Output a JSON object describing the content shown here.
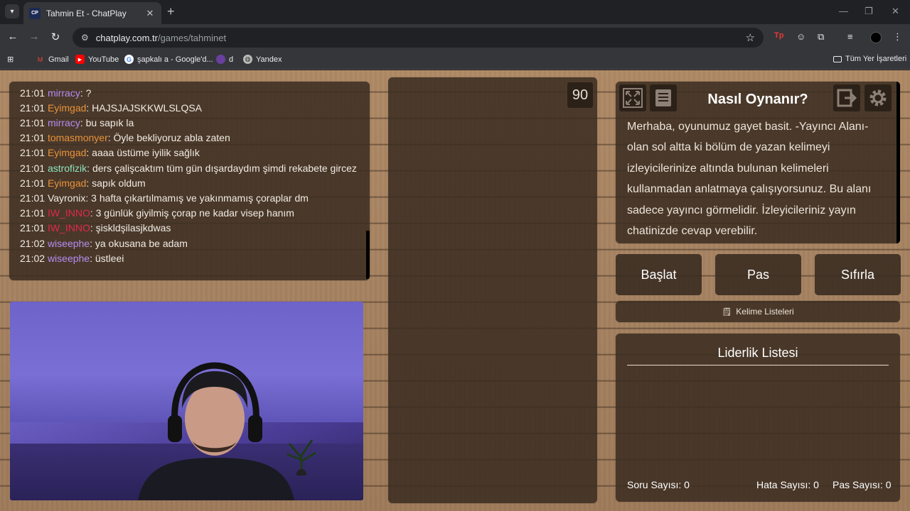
{
  "browser": {
    "tab_title": "Tahmin Et - ChatPlay",
    "tab_favicon": "CP",
    "url_host": "chatplay.com.tr",
    "url_path": "/games/tahminet",
    "bookmarks": [
      {
        "label": "Gmail",
        "icon": "gmail-icon"
      },
      {
        "label": "YouTube",
        "icon": "youtube-icon"
      },
      {
        "label": "şapkalı a - Google'd...",
        "icon": "google-icon"
      },
      {
        "label": "d",
        "icon": "avatar-icon"
      },
      {
        "label": "Yandex",
        "icon": "globe-icon"
      }
    ],
    "all_bookmarks": "Tüm Yer İşaretleri"
  },
  "chat": {
    "messages": [
      {
        "time": "21:01",
        "user": "mirracy",
        "color": "#b58cf2",
        "text": ": ?"
      },
      {
        "time": "21:01",
        "user": "Eyimgad",
        "color": "#e8923a",
        "text": ": HAJSJAJSKKWLSLQSA"
      },
      {
        "time": "21:01",
        "user": "mirracy",
        "color": "#b58cf2",
        "text": ": bu sapık la"
      },
      {
        "time": "21:01",
        "user": "tomasmonyer",
        "color": "#e8923a",
        "text": ": Öyle bekliyoruz abla zaten"
      },
      {
        "time": "21:01",
        "user": "Eyimgad",
        "color": "#e8923a",
        "text": ": aaaa üstüme iyilik sağlık"
      },
      {
        "time": "21:01",
        "user": "astrofizik",
        "color": "#8fe3c0",
        "text": ": ders çalişcaktım tüm gün dışardaydım şimdi rekabete gircez"
      },
      {
        "time": "21:01",
        "user": "Eyimgad",
        "color": "#e8923a",
        "text": ": sapık oldum"
      },
      {
        "time": "21:01",
        "user": "Vayronix",
        "color": "#f1ebe4",
        "text": ": 3 hafta çıkartılmamış ve yakınmamış çoraplar dm"
      },
      {
        "time": "21:01",
        "user": "IW_INNO",
        "color": "#e0284a",
        "text": ": 3 günlük giyilmiş çorap ne kadar visep hanım"
      },
      {
        "time": "21:01",
        "user": "IW_INNO",
        "color": "#e0284a",
        "text": ": şiskldşilasjkdwas"
      },
      {
        "time": "21:02",
        "user": "wiseephe",
        "color": "#b58cf2",
        "text": ": ya okusana be adam"
      },
      {
        "time": "21:02",
        "user": "wiseephe",
        "color": "#b58cf2",
        "text": ": üstleei"
      }
    ]
  },
  "game": {
    "timer": "90",
    "howto_title": "Nasıl Oynanır?",
    "howto_text": "Merhaba, oyunumuz gayet basit. -Yayıncı Alanı- olan sol altta ki bölüm de yazan kelimeyi izleyicilerinize altında bulunan kelimeleri kullanmadan anlatmaya çalışıyorsunuz. Bu alanı sadece yayıncı görmelidir. İzleyicileriniz yayın chatinizde cevap verebilir.",
    "buttons": {
      "start": "Başlat",
      "pass": "Pas",
      "reset": "Sıfırla"
    },
    "word_lists": "Kelime Listeleri",
    "leaderboard_title": "Liderlik Listesi",
    "stats": {
      "questions": "Soru Sayısı: 0",
      "errors": "Hata Sayısı: 0",
      "passes": "Pas Sayısı: 0"
    }
  }
}
